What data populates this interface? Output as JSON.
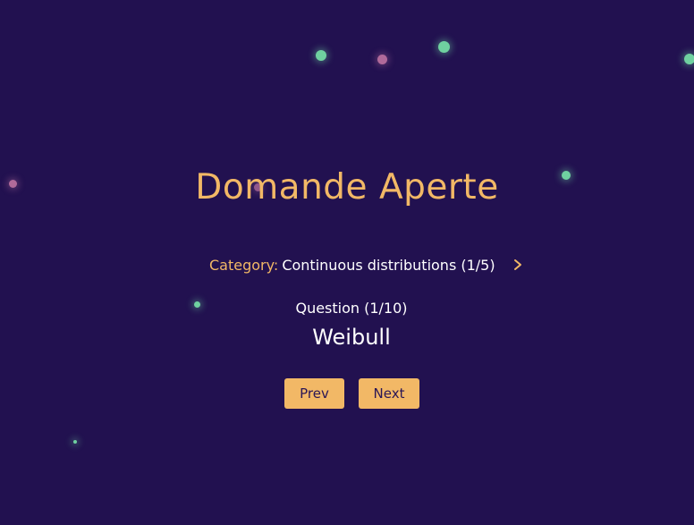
{
  "page": {
    "title": "Domande Aperte"
  },
  "category": {
    "label": "Category:",
    "value": "Continuous distributions (1/5)",
    "next_icon": "chevron-right-icon"
  },
  "question": {
    "counter": "Question (1/10)",
    "text": "Weibull"
  },
  "navigation": {
    "prev_label": "Prev",
    "next_label": "Next"
  },
  "colors": {
    "background": "#221150",
    "accent": "#f2b866",
    "text": "#ffffff",
    "particle_green": "#6fd1a0",
    "particle_pink": "#b06a9a"
  }
}
